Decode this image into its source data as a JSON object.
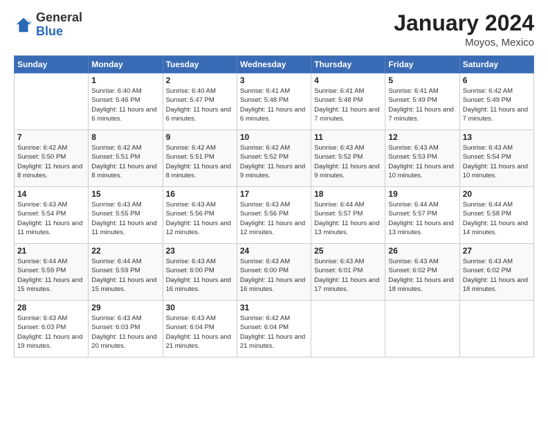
{
  "header": {
    "logo_general": "General",
    "logo_blue": "Blue",
    "month_year": "January 2024",
    "location": "Moyos, Mexico"
  },
  "days_of_week": [
    "Sunday",
    "Monday",
    "Tuesday",
    "Wednesday",
    "Thursday",
    "Friday",
    "Saturday"
  ],
  "weeks": [
    [
      {
        "day": "",
        "sunrise": "",
        "sunset": "",
        "daylight": ""
      },
      {
        "day": "1",
        "sunrise": "Sunrise: 6:40 AM",
        "sunset": "Sunset: 5:46 PM",
        "daylight": "Daylight: 11 hours and 6 minutes."
      },
      {
        "day": "2",
        "sunrise": "Sunrise: 6:40 AM",
        "sunset": "Sunset: 5:47 PM",
        "daylight": "Daylight: 11 hours and 6 minutes."
      },
      {
        "day": "3",
        "sunrise": "Sunrise: 6:41 AM",
        "sunset": "Sunset: 5:48 PM",
        "daylight": "Daylight: 11 hours and 6 minutes."
      },
      {
        "day": "4",
        "sunrise": "Sunrise: 6:41 AM",
        "sunset": "Sunset: 5:48 PM",
        "daylight": "Daylight: 11 hours and 7 minutes."
      },
      {
        "day": "5",
        "sunrise": "Sunrise: 6:41 AM",
        "sunset": "Sunset: 5:49 PM",
        "daylight": "Daylight: 11 hours and 7 minutes."
      },
      {
        "day": "6",
        "sunrise": "Sunrise: 6:42 AM",
        "sunset": "Sunset: 5:49 PM",
        "daylight": "Daylight: 11 hours and 7 minutes."
      }
    ],
    [
      {
        "day": "7",
        "sunrise": "Sunrise: 6:42 AM",
        "sunset": "Sunset: 5:50 PM",
        "daylight": "Daylight: 11 hours and 8 minutes."
      },
      {
        "day": "8",
        "sunrise": "Sunrise: 6:42 AM",
        "sunset": "Sunset: 5:51 PM",
        "daylight": "Daylight: 11 hours and 8 minutes."
      },
      {
        "day": "9",
        "sunrise": "Sunrise: 6:42 AM",
        "sunset": "Sunset: 5:51 PM",
        "daylight": "Daylight: 11 hours and 8 minutes."
      },
      {
        "day": "10",
        "sunrise": "Sunrise: 6:42 AM",
        "sunset": "Sunset: 5:52 PM",
        "daylight": "Daylight: 11 hours and 9 minutes."
      },
      {
        "day": "11",
        "sunrise": "Sunrise: 6:43 AM",
        "sunset": "Sunset: 5:52 PM",
        "daylight": "Daylight: 11 hours and 9 minutes."
      },
      {
        "day": "12",
        "sunrise": "Sunrise: 6:43 AM",
        "sunset": "Sunset: 5:53 PM",
        "daylight": "Daylight: 11 hours and 10 minutes."
      },
      {
        "day": "13",
        "sunrise": "Sunrise: 6:43 AM",
        "sunset": "Sunset: 5:54 PM",
        "daylight": "Daylight: 11 hours and 10 minutes."
      }
    ],
    [
      {
        "day": "14",
        "sunrise": "Sunrise: 6:43 AM",
        "sunset": "Sunset: 5:54 PM",
        "daylight": "Daylight: 11 hours and 11 minutes."
      },
      {
        "day": "15",
        "sunrise": "Sunrise: 6:43 AM",
        "sunset": "Sunset: 5:55 PM",
        "daylight": "Daylight: 11 hours and 11 minutes."
      },
      {
        "day": "16",
        "sunrise": "Sunrise: 6:43 AM",
        "sunset": "Sunset: 5:56 PM",
        "daylight": "Daylight: 11 hours and 12 minutes."
      },
      {
        "day": "17",
        "sunrise": "Sunrise: 6:43 AM",
        "sunset": "Sunset: 5:56 PM",
        "daylight": "Daylight: 11 hours and 12 minutes."
      },
      {
        "day": "18",
        "sunrise": "Sunrise: 6:44 AM",
        "sunset": "Sunset: 5:57 PM",
        "daylight": "Daylight: 11 hours and 13 minutes."
      },
      {
        "day": "19",
        "sunrise": "Sunrise: 6:44 AM",
        "sunset": "Sunset: 5:57 PM",
        "daylight": "Daylight: 11 hours and 13 minutes."
      },
      {
        "day": "20",
        "sunrise": "Sunrise: 6:44 AM",
        "sunset": "Sunset: 5:58 PM",
        "daylight": "Daylight: 11 hours and 14 minutes."
      }
    ],
    [
      {
        "day": "21",
        "sunrise": "Sunrise: 6:44 AM",
        "sunset": "Sunset: 5:59 PM",
        "daylight": "Daylight: 11 hours and 15 minutes."
      },
      {
        "day": "22",
        "sunrise": "Sunrise: 6:44 AM",
        "sunset": "Sunset: 5:59 PM",
        "daylight": "Daylight: 11 hours and 15 minutes."
      },
      {
        "day": "23",
        "sunrise": "Sunrise: 6:43 AM",
        "sunset": "Sunset: 6:00 PM",
        "daylight": "Daylight: 11 hours and 16 minutes."
      },
      {
        "day": "24",
        "sunrise": "Sunrise: 6:43 AM",
        "sunset": "Sunset: 6:00 PM",
        "daylight": "Daylight: 11 hours and 16 minutes."
      },
      {
        "day": "25",
        "sunrise": "Sunrise: 6:43 AM",
        "sunset": "Sunset: 6:01 PM",
        "daylight": "Daylight: 11 hours and 17 minutes."
      },
      {
        "day": "26",
        "sunrise": "Sunrise: 6:43 AM",
        "sunset": "Sunset: 6:02 PM",
        "daylight": "Daylight: 11 hours and 18 minutes."
      },
      {
        "day": "27",
        "sunrise": "Sunrise: 6:43 AM",
        "sunset": "Sunset: 6:02 PM",
        "daylight": "Daylight: 11 hours and 18 minutes."
      }
    ],
    [
      {
        "day": "28",
        "sunrise": "Sunrise: 6:43 AM",
        "sunset": "Sunset: 6:03 PM",
        "daylight": "Daylight: 11 hours and 19 minutes."
      },
      {
        "day": "29",
        "sunrise": "Sunrise: 6:43 AM",
        "sunset": "Sunset: 6:03 PM",
        "daylight": "Daylight: 11 hours and 20 minutes."
      },
      {
        "day": "30",
        "sunrise": "Sunrise: 6:43 AM",
        "sunset": "Sunset: 6:04 PM",
        "daylight": "Daylight: 11 hours and 21 minutes."
      },
      {
        "day": "31",
        "sunrise": "Sunrise: 6:42 AM",
        "sunset": "Sunset: 6:04 PM",
        "daylight": "Daylight: 11 hours and 21 minutes."
      },
      {
        "day": "",
        "sunrise": "",
        "sunset": "",
        "daylight": ""
      },
      {
        "day": "",
        "sunrise": "",
        "sunset": "",
        "daylight": ""
      },
      {
        "day": "",
        "sunrise": "",
        "sunset": "",
        "daylight": ""
      }
    ]
  ]
}
